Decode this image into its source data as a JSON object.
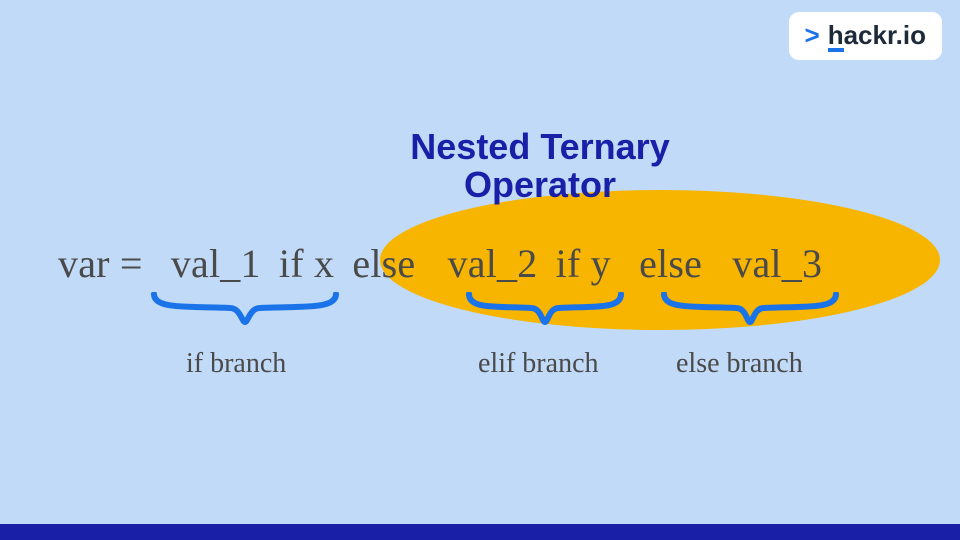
{
  "logo": {
    "chevron": ">",
    "prefix": "h",
    "rest": "ackr.io"
  },
  "title": {
    "line1": "Nested Ternary",
    "line2": "Operator"
  },
  "code": {
    "lhs": "var =",
    "val1": "val_1",
    "ifx": "if x",
    "else1": "else",
    "val2": "val_2",
    "ify": "if y",
    "else2": "else",
    "val3": "val_3"
  },
  "branches": {
    "if": "if branch",
    "elif": "elif branch",
    "else": "else branch"
  },
  "colors": {
    "bg": "#c0daf7",
    "accent": "#1a1fa8",
    "highlight": "#f7b500",
    "brace": "#1a73e8",
    "text": "#4a4a4a"
  }
}
